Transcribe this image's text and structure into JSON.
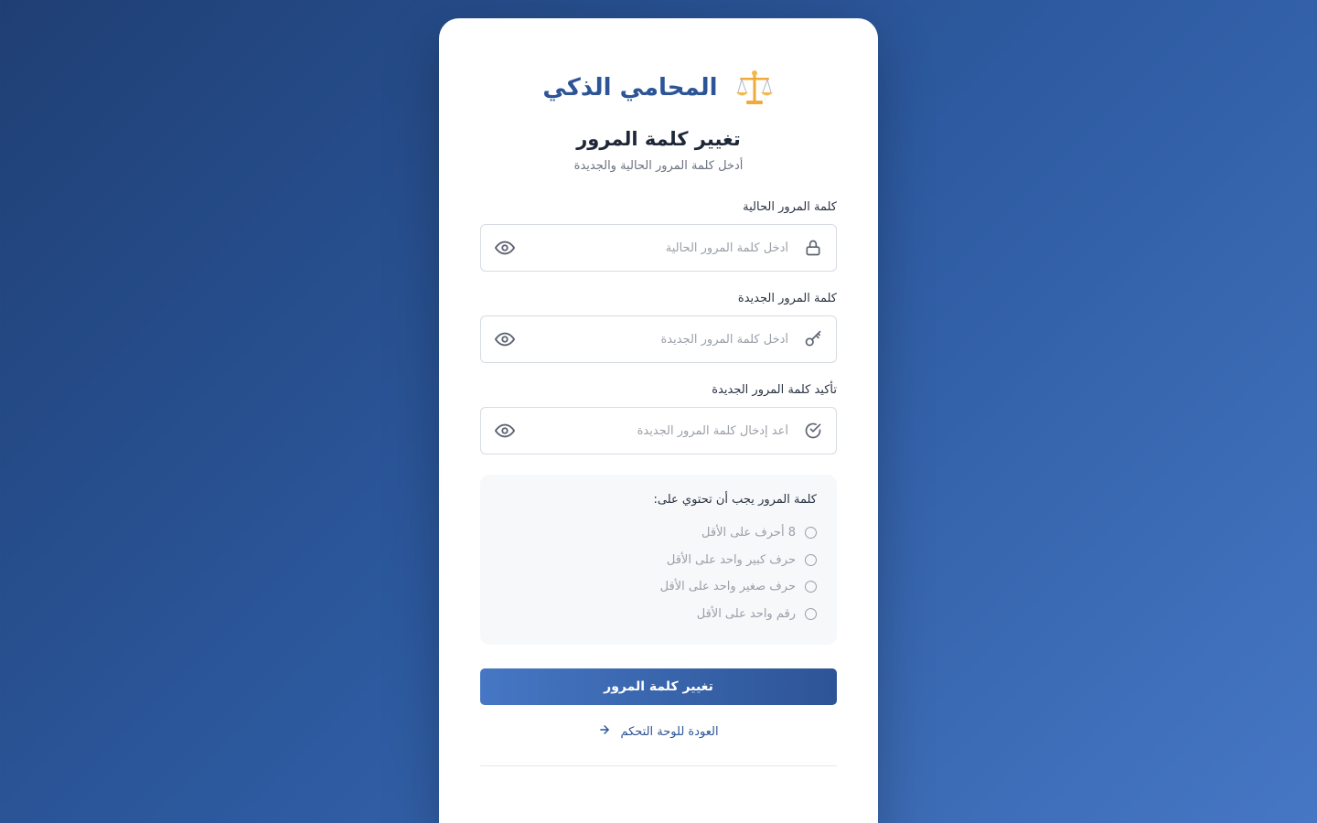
{
  "brand": {
    "name": "المحامي الذكي",
    "icon": "scales-icon"
  },
  "form": {
    "title": "تغيير كلمة المرور",
    "subtitle": "أدخل كلمة المرور الحالية والجديدة",
    "fields": [
      {
        "label": "كلمة المرور الحالية",
        "placeholder": "أدخل كلمة المرور الحالية",
        "value": "",
        "lead_icon": "lock-icon",
        "toggle_icon": "eye-icon"
      },
      {
        "label": "كلمة المرور الجديدة",
        "placeholder": "أدخل كلمة المرور الجديدة",
        "value": "",
        "lead_icon": "key-icon",
        "toggle_icon": "eye-icon"
      },
      {
        "label": "تأكيد كلمة المرور الجديدة",
        "placeholder": "أعد إدخال كلمة المرور الجديدة",
        "value": "",
        "lead_icon": "check-circle-icon",
        "toggle_icon": "eye-icon"
      }
    ],
    "requirements": {
      "title": "كلمة المرور يجب أن تحتوي على:",
      "items": [
        "8 أحرف على الأقل",
        "حرف كبير واحد على الأقل",
        "حرف صغير واحد على الأقل",
        "رقم واحد على الأقل"
      ]
    },
    "submit_label": "تغيير كلمة المرور",
    "back_label": "العودة للوحة التحكم"
  },
  "colors": {
    "primary": "#2c5496",
    "accent": "#4677c4",
    "background_start": "#1f3f74",
    "background_end": "#4677c4"
  }
}
